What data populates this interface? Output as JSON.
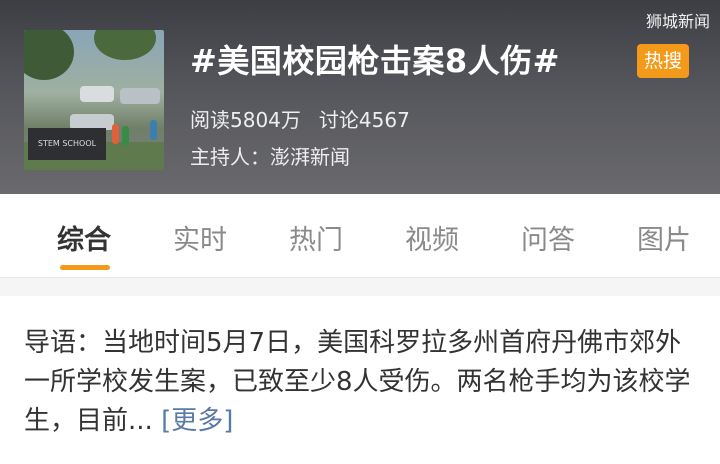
{
  "watermark": "狮城新闻",
  "topic": {
    "title": "#美国校园枪击案8人伤#",
    "badge": "热搜",
    "read_label": "阅读5804万",
    "discuss_label": "讨论4567",
    "host_label": "主持人：澎湃新闻",
    "thumbnail_sign": "STEM SCHOOL"
  },
  "tabs": [
    {
      "label": "综合",
      "active": true
    },
    {
      "label": "实时",
      "active": false
    },
    {
      "label": "热门",
      "active": false
    },
    {
      "label": "视频",
      "active": false
    },
    {
      "label": "问答",
      "active": false
    },
    {
      "label": "图片",
      "active": false
    }
  ],
  "colors": {
    "accent": "#f49a1a",
    "link": "#5a7aa6"
  },
  "summary": {
    "text": "导语：当地时间5月7日，美国科罗拉多州首府丹佛市郊外一所学校发生案，已致至少8人受伤。两名枪手均为该校学生，目前...",
    "more_label": "[更多]"
  }
}
